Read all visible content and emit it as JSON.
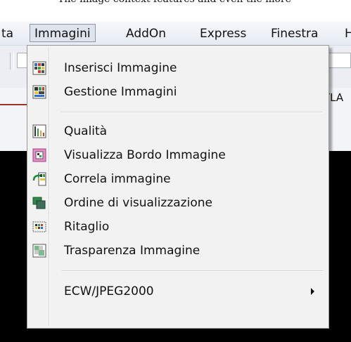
{
  "top_caption": "The image context features and even the more",
  "menubar": {
    "items": [
      {
        "label": "ta"
      },
      {
        "label": "Immagini"
      },
      {
        "label": "AddOn"
      },
      {
        "label": "Express"
      },
      {
        "label": "Finestra"
      },
      {
        "label": "H"
      }
    ]
  },
  "background": {
    "right_text": "YLA"
  },
  "menu": {
    "items": [
      {
        "label": "Inserisci Immagine",
        "icon": "insert-image-icon"
      },
      {
        "label": "Gestione Immagini",
        "icon": "manage-images-icon"
      },
      {
        "label": "Qualità",
        "icon": "quality-icon"
      },
      {
        "label": "Visualizza Bordo Immagine",
        "icon": "image-border-icon"
      },
      {
        "label": "Correla immagine",
        "icon": "correlate-image-icon"
      },
      {
        "label": "Ordine di visualizzazione",
        "icon": "draw-order-icon"
      },
      {
        "label": "Ritaglio",
        "icon": "clip-icon"
      },
      {
        "label": "Trasparenza Immagine",
        "icon": "transparency-icon"
      },
      {
        "label": "ECW/JPEG2000",
        "icon": ""
      }
    ]
  },
  "colors": {
    "menu_bg": "#f2f2f2",
    "menu_border": "#979797",
    "canvas_bg": "#000000"
  }
}
